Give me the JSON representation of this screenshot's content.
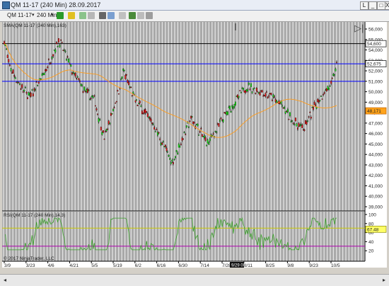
{
  "window": {
    "title": "QM 11-17 (240 Min)  28.09.2017",
    "minimize_label": "_",
    "maximize_label": "□",
    "close_label": "X",
    "restore_label": "L"
  },
  "toolbar": {
    "instrument": "QM 11-17",
    "period": "240 Min",
    "icons": [
      "bar-type-icon",
      "pen-icon",
      "crosshair-icon",
      "zoom-icon",
      "properties-icon",
      "indicator-icon",
      "strategy-icon",
      "print-icon"
    ]
  },
  "chart_data": [
    {
      "type": "line",
      "title": "SMA(QM 11-17 (240 Min),163)",
      "series": [
        {
          "name": "QM 11-17",
          "role": "ohlc-bars"
        },
        {
          "name": "SMA(QM 11-17 (240 Min),163)",
          "color": "#ff9b1a"
        }
      ],
      "x_tick_labels": [
        "3/9",
        "3/23",
        "4/6",
        "4/21",
        "5/5",
        "5/19",
        "6/2",
        "6/16",
        "6/30",
        "7/14",
        "7/28",
        "8/11",
        "8/25",
        "9/8",
        "9/23",
        "10/5"
      ],
      "y_tick_labels": [
        "56,000",
        "55,000",
        "54,000",
        "53,000",
        "52,000",
        "51,000",
        "50,000",
        "49,000",
        "48,000",
        "47,000",
        "46,000",
        "45,000",
        "44,000",
        "43,000",
        "42,000",
        "41,000",
        "40,000",
        "39,000"
      ],
      "ylim": [
        39000,
        56000
      ],
      "horizontal_lines": [
        {
          "value": 54600,
          "label": "54,600",
          "color": "#000000"
        },
        {
          "value": 52675,
          "label": "52,675",
          "color": "#0000ff"
        },
        {
          "value": 51000,
          "color": "#0000ff"
        }
      ],
      "last_sma_label": "48,171",
      "grid": true,
      "highlighted_x_label": "9/29 00"
    },
    {
      "type": "line",
      "title": "RSI(QM 11-17 (240 Min),14,3)",
      "series": [
        {
          "name": "RSI(QM 11-17 (240 Min),14,3)",
          "color": "#3aa02a"
        }
      ],
      "y_tick_labels": [
        "100",
        "80",
        "60",
        "40",
        "20"
      ],
      "ylim": [
        0,
        100
      ],
      "horizontal_lines": [
        {
          "value": 70,
          "color": "#c8c800"
        },
        {
          "value": 30,
          "color": "#b000b0"
        }
      ],
      "last_value_label": "67.48"
    }
  ],
  "copyright": "© 2017 NinjaTrader, LLC",
  "colors": {
    "up_candle": "#10e010",
    "down_candle": "#e01010",
    "background_stripe": "#a8a8a8"
  }
}
